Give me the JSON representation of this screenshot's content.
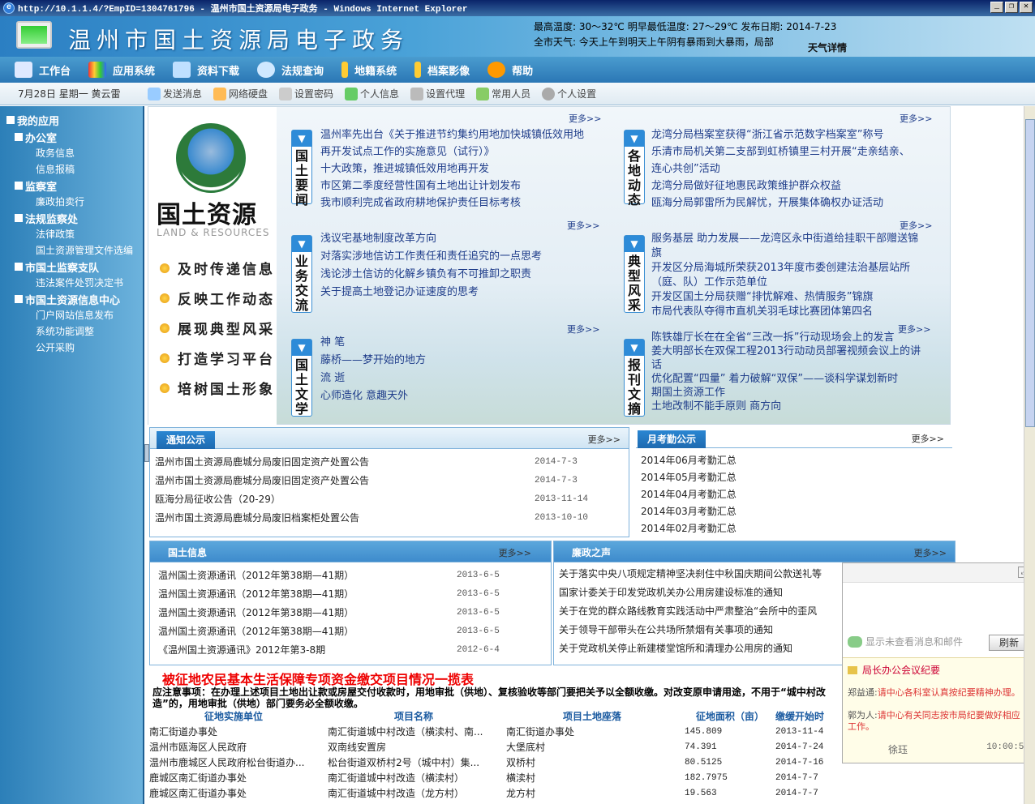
{
  "window": {
    "title": "http://10.1.1.4/?EmpID=1304761796 - 温州市国土资源局电子政务 - Windows Internet Explorer"
  },
  "header": {
    "site_title": "温州市国土资源局电子政务",
    "weather_line1": "最高温度:  30～32℃   明早最低温度:  27～29℃       发布日期:   2014-7-23",
    "weather_line2": "全市天气: 今天上午到明天上午阴有暴雨到大暴雨，局部",
    "weather_link": "天气详情"
  },
  "topnav": {
    "items": [
      "工作台",
      "应用系统",
      "资料下载",
      "法规查询",
      "地籍系统",
      "档案影像",
      "帮助"
    ]
  },
  "toolbar": {
    "date": "7月28日 星期一   黄云雷",
    "items": [
      "发送消息",
      "网络硬盘",
      "设置密码",
      "个人信息",
      "设置代理",
      "常用人员",
      "个人设置"
    ]
  },
  "sidebar": {
    "head": "我的应用",
    "groups": [
      {
        "name": "办公室",
        "items": [
          "政务信息",
          "信息报稿"
        ]
      },
      {
        "name": "监察室",
        "items": [
          "廉政拍卖行"
        ]
      },
      {
        "name": "法规监察处",
        "items": [
          "法律政策",
          "国土资源管理文件选编"
        ]
      },
      {
        "name": "市国土监察支队",
        "items": [
          "违法案件处罚决定书"
        ]
      },
      {
        "name": "市国土资源信息中心",
        "items": [
          "门户网站信息发布",
          "系统功能调整",
          "公开采购"
        ]
      }
    ]
  },
  "logo": {
    "cn": "国土资源",
    "en": "LAND & RESOURCES",
    "slogans": [
      "及时传递信息",
      "反映工作动态",
      "展现典型风采",
      "打造学习平台",
      "培树国土形象"
    ]
  },
  "more": "更多>>",
  "news": {
    "guotu_yaowen": {
      "label": "国土要闻",
      "items": [
        "温州率先出台《关于推进节约集约用地加快城镇低效用地",
        "再开发试点工作的实施意见（试行）》",
        "十大政策，推进城镇低效用地再开发",
        "市区第二季度经营性国有土地出让计划发布",
        "我市顺利完成省政府耕地保护责任目标考核"
      ]
    },
    "gedi_dongtai": {
      "label": "各地动态",
      "items": [
        "龙湾分局档案室获得“浙江省示范数字档案室”称号",
        "乐清市局机关第二支部到虹桥镇里三村开展“走亲结亲、",
        "连心共创”活动",
        "龙湾分局做好征地惠民政策维护群众权益",
        "瓯海分局郭雷所为民解忧，开展集体确权办证活动"
      ]
    },
    "yewu_jiaoliu": {
      "label": "业务交流",
      "items": [
        "浅议宅基地制度改革方向",
        "对落实涉地信访工作责任和责任追究的一点思考",
        "浅论涉土信访的化解乡镇负有不可推卸之职责",
        "关于提高土地登记办证速度的思考"
      ]
    },
    "dianxing_fengcai": {
      "label": "典型风采",
      "items": [
        "服务基层 助力发展——龙湾区永中街道给挂职干部赠送锦",
        "旗",
        "开发区分局海城所荣获2013年度市委创建法治基层站所",
        "（庭、队）工作示范单位",
        "开发区国土分局获赠“排忧解难、热情服务”锦旗",
        "市局代表队夺得市直机关羽毛球比赛团体第四名"
      ]
    },
    "guotu_wenxue": {
      "label": "国土文学",
      "items": [
        "神  笔",
        "藤桥——梦开始的地方",
        "流  逝",
        "心师造化 意趣天外"
      ]
    },
    "baokan_wenzhai": {
      "label": "报刊文摘",
      "items": [
        "陈铁雄厅长在在全省“三改一拆”行动现场会上的发言",
        "姜大明部长在双保工程2013行动动员部署视频会议上的讲",
        "话",
        "优化配置“四量” 着力破解“双保”——谈科学谋划新时",
        "期国土资源工作",
        "土地改制不能手原则  商方向"
      ]
    }
  },
  "panels": {
    "tongzhi": {
      "title": "通知公示",
      "rows": [
        {
          "t": "温州市国土资源局鹿城分局废旧固定资产处置公告",
          "d": "2014-7-3"
        },
        {
          "t": "温州市国土资源局鹿城分局废旧固定资产处置公告",
          "d": "2014-7-3"
        },
        {
          "t": "瓯海分局征收公告（20-29）",
          "d": "2013-11-14"
        },
        {
          "t": "温州市国土资源局鹿城分局废旧档案柜处置公告",
          "d": "2013-10-10"
        }
      ]
    },
    "kaoqin": {
      "title": "月考勤公示",
      "rows": [
        "2014年06月考勤汇总",
        "2014年05月考勤汇总",
        "2014年04月考勤汇总",
        "2014年03月考勤汇总",
        "2014年02月考勤汇总"
      ]
    },
    "guotu_xinxi": {
      "title": "国土信息",
      "rows": [
        {
          "t": "温州国土资源通讯（2012年第38期—41期）",
          "d": "2013-6-5"
        },
        {
          "t": "温州国土资源通讯（2012年第38期—41期）",
          "d": "2013-6-5"
        },
        {
          "t": "温州国土资源通讯（2012年第38期—41期）",
          "d": "2013-6-5"
        },
        {
          "t": "温州国土资源通讯（2012年第38期—41期）",
          "d": "2013-6-5"
        },
        {
          "t": "《温州国土资源通讯》2012年第3-8期",
          "d": "2012-6-4"
        }
      ]
    },
    "lianzheng": {
      "title": "廉政之声",
      "rows": [
        "关于落实中央八项规定精神坚决刹住中秋国庆期间公款送礼等",
        "国家计委关于印发党政机关办公用房建设标准的通知",
        "关于在党的群众路线教育实践活动中严肃整治“会所中的歪风",
        "关于领导干部带头在公共场所禁烟有关事项的通知",
        "关于党政机关停止新建楼堂馆所和清理办公用房的通知"
      ]
    }
  },
  "table": {
    "title": "被征地农民基本生活保障专项资金缴交项目情况一揽表",
    "note": "应注意事项：在办理上述项目土地出让款或房屋交付收款时，用地审批（供地）、复核验收等部门要把关予以全额收缴。对改变原申请用途，不用于“城中村改造”的，用地审批（供地）部门要务必全额收缴。",
    "headers": [
      "征地实施单位",
      "项目名称",
      "项目土地座落",
      "征地面积（亩）",
      "缴缓开始时"
    ],
    "rows": [
      [
        "南汇街道办事处",
        "南汇街道城中村改造（横渎村、南...",
        "南汇街道办事处",
        "145.809",
        "2013-11-4"
      ],
      [
        "温州市瓯海区人民政府",
        "双南线安置房",
        "大堡底村",
        "74.391",
        "2014-7-24"
      ],
      [
        "温州市鹿城区人民政府松台街道办...",
        "松台街道双桥村2号（城中村）集...",
        "双桥村",
        "80.5125",
        "2014-7-16"
      ],
      [
        "鹿城区南汇街道办事处",
        "南汇街道城中村改造（横渎村）",
        "横渎村",
        "182.7975",
        "2014-7-7"
      ],
      [
        "鹿城区南汇街道办事处",
        "南汇街道城中村改造（龙方村）",
        "龙方村",
        "19.563",
        "2014-7-7"
      ]
    ]
  },
  "popup": {
    "msg": "显示未查看消息和邮件",
    "refresh": "刷新",
    "memo_title": "局长办公会议纪要",
    "line1_label": "郑益通:",
    "line1": "请中心各科室认真按纪要精神办理。",
    "line2_label": "郭为人:",
    "line2": "请中心有关同志按市局纪要做好相应工作。",
    "who": "徐珏",
    "time": "10:00:57"
  }
}
